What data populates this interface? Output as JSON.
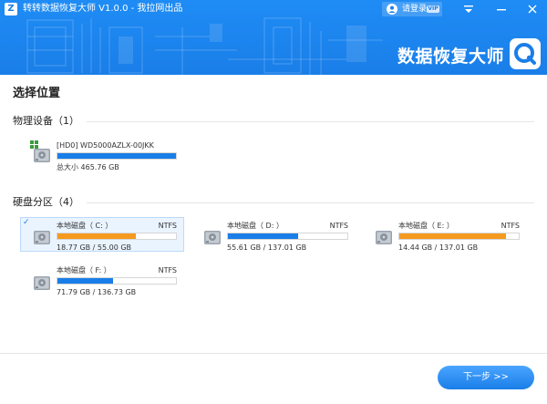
{
  "app": {
    "title": "转转数据恢复大师 V1.0.0 - 我拉网出品",
    "logo_letter": "Z",
    "login_label": "请登录",
    "vip_badge": "VIP",
    "brand_text": "数据恢复大师",
    "accent_color": "#1a7ee8"
  },
  "window_controls": {
    "menu_icon": "menu-icon",
    "minimize_icon": "minimize-icon",
    "close_icon": "close-icon"
  },
  "page": {
    "title": "选择位置"
  },
  "physical_devices": {
    "heading": "物理设备（1）",
    "items": [
      {
        "name": "[HD0] WD5000AZLX-00JKK",
        "size_text": "总大小 465.76 GB",
        "usage_fraction": 1.0,
        "bar_color": "#1a7ee8"
      }
    ]
  },
  "partitions": {
    "heading": "硬盘分区（4）",
    "items": [
      {
        "name": "本地磁盘（ C: ）",
        "fs": "NTFS",
        "size_text": "18.77 GB / 55.00 GB",
        "usage_fraction": 0.66,
        "bar_color": "#f59a1f",
        "selected": true
      },
      {
        "name": "本地磁盘（ D: ）",
        "fs": "NTFS",
        "size_text": "55.61 GB / 137.01 GB",
        "usage_fraction": 0.59,
        "bar_color": "#1a7ee8",
        "selected": false
      },
      {
        "name": "本地磁盘（ E: ）",
        "fs": "NTFS",
        "size_text": "14.44 GB / 137.01 GB",
        "usage_fraction": 0.89,
        "bar_color": "#f59a1f",
        "selected": false
      },
      {
        "name": "本地磁盘（ F: ）",
        "fs": "NTFS",
        "size_text": "71.79 GB / 136.73 GB",
        "usage_fraction": 0.47,
        "bar_color": "#1a7ee8",
        "selected": false
      }
    ]
  },
  "footer": {
    "next_label": "下一步 >>"
  }
}
